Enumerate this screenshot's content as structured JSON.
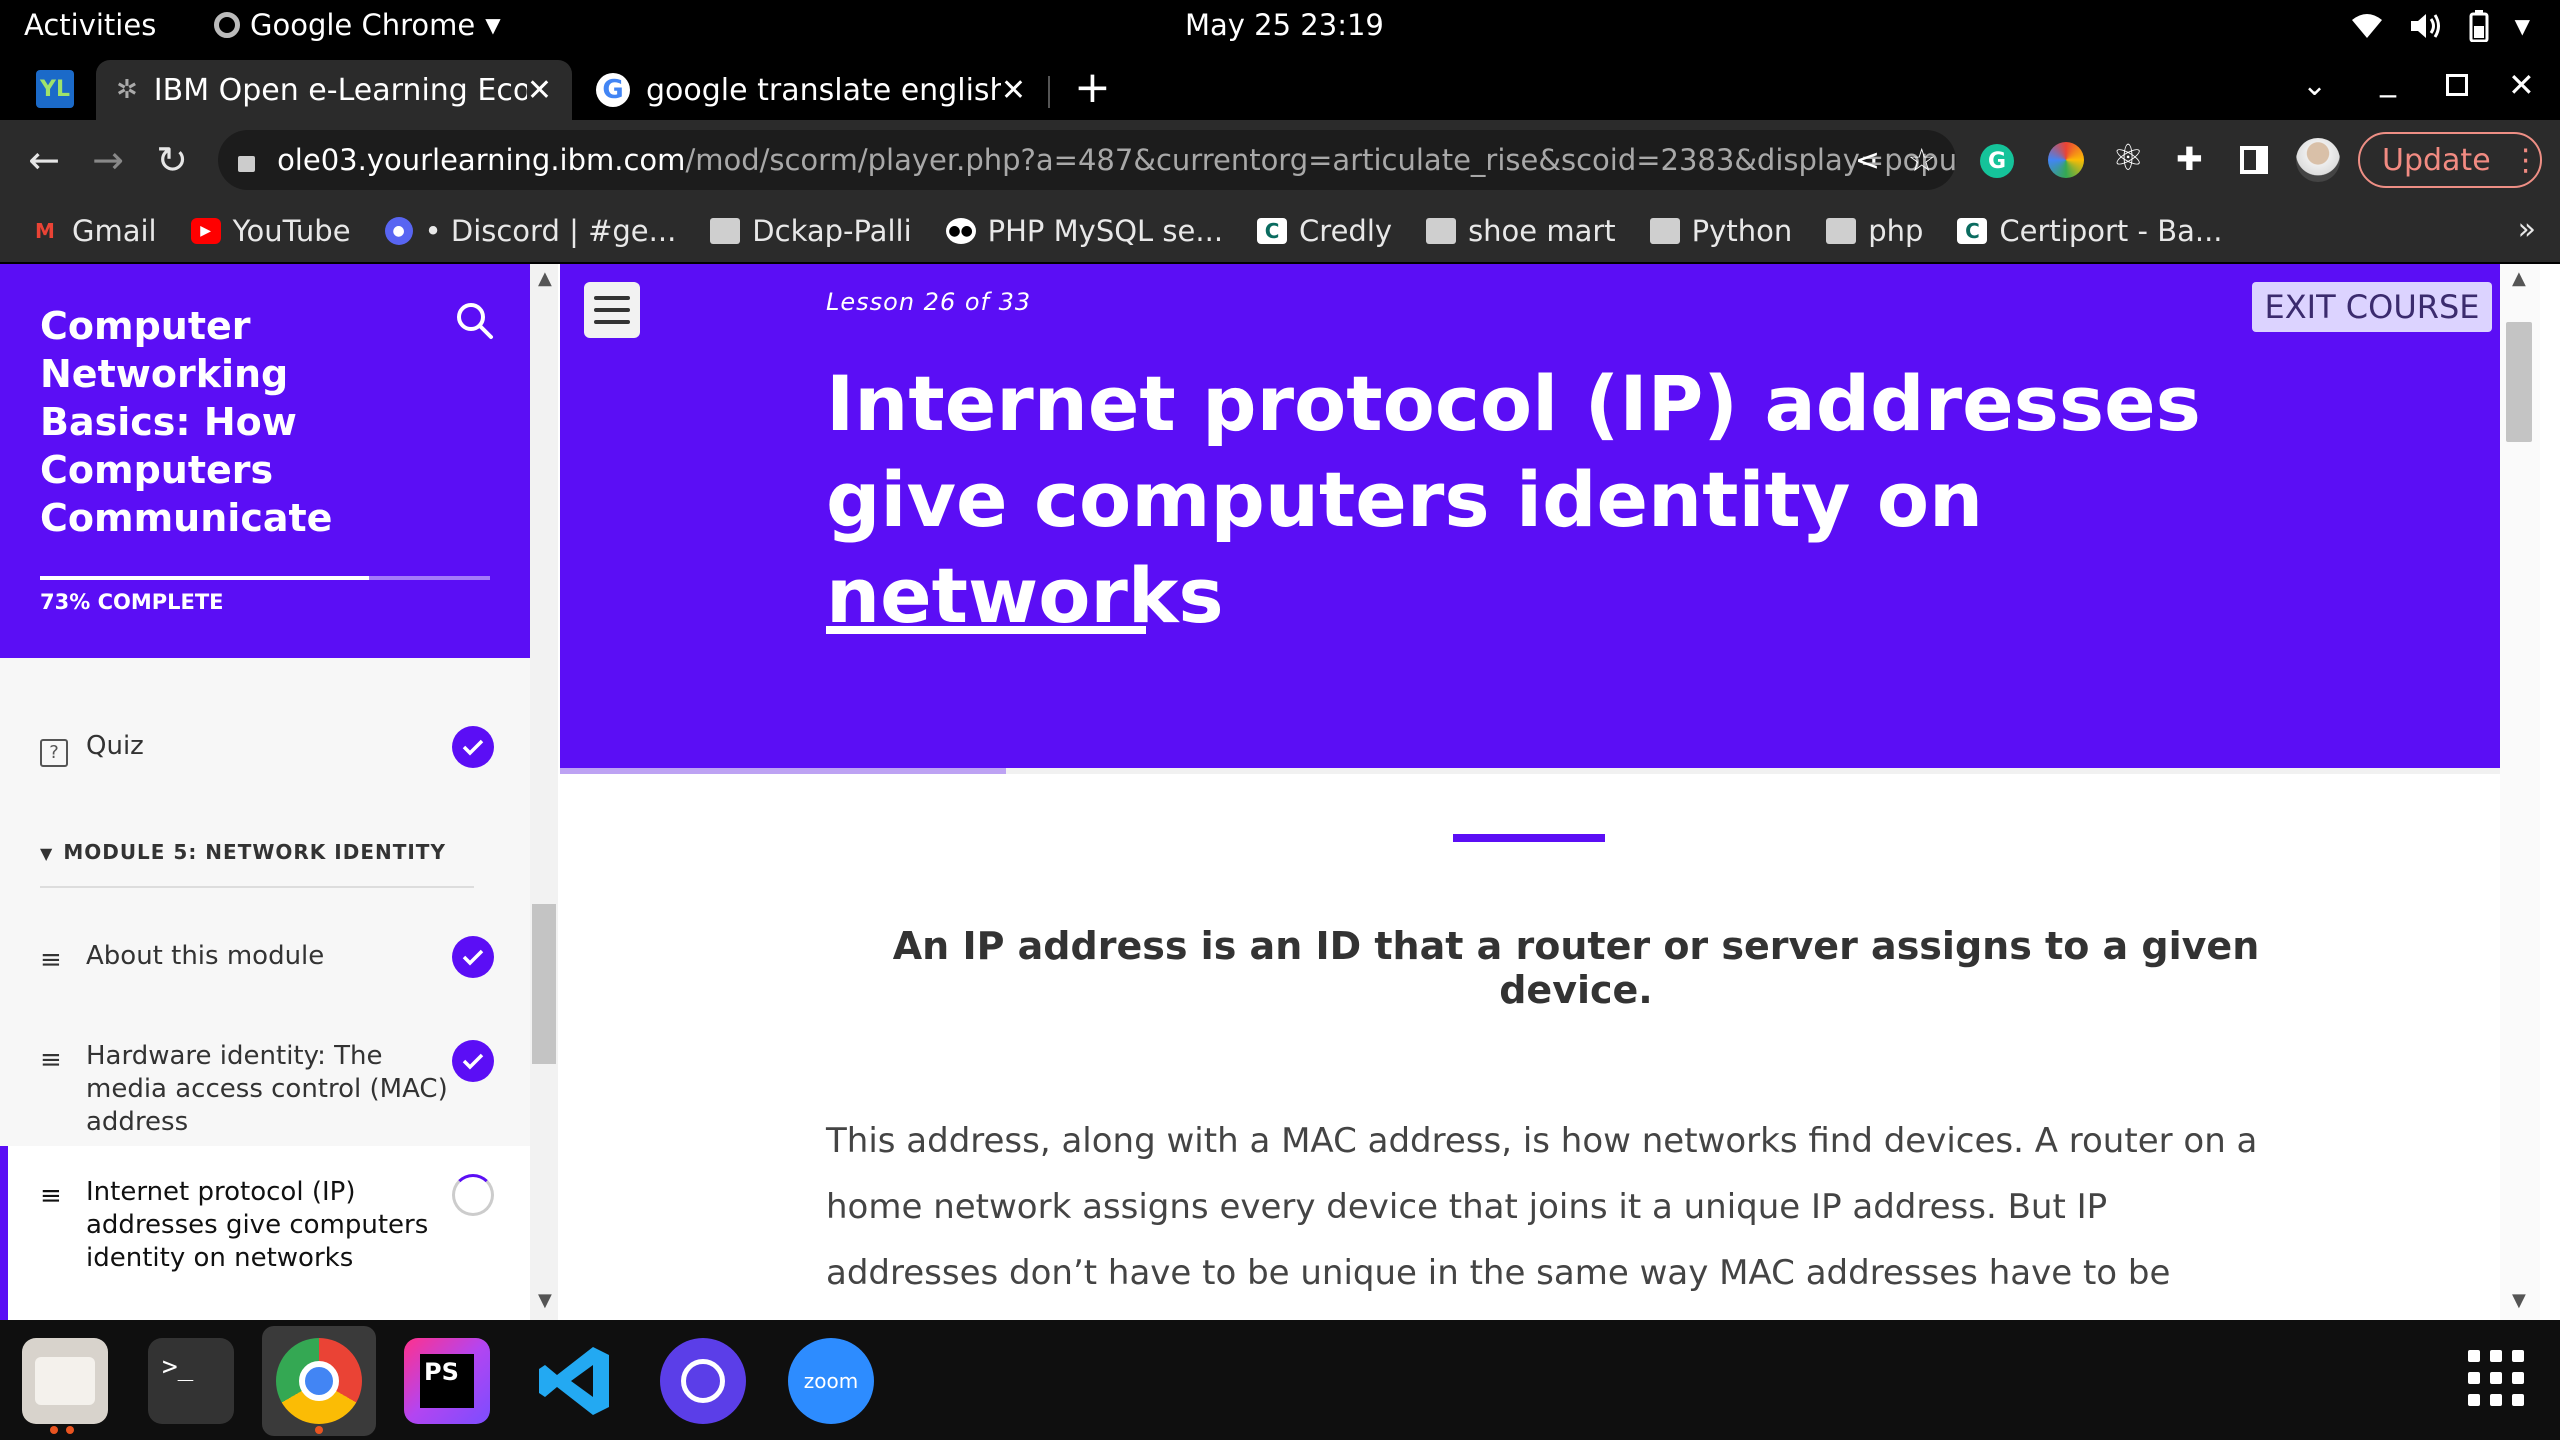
{
  "topbar": {
    "activities": "Activities",
    "app_name": "Google Chrome",
    "clock": "May 25  23:19"
  },
  "tabs": [
    {
      "title": "IBM Open e-Learning Ecos",
      "active": true
    },
    {
      "title": "google translate english t",
      "active": false
    }
  ],
  "omnibox": {
    "host": "ole03.yourlearning.ibm.com",
    "path": "/mod/scorm/player.php?a=487&currentorg=articulate_rise&scoid=2383&display=popup&..."
  },
  "update_label": "Update",
  "bookmarks": [
    {
      "label": "Gmail",
      "icon": "gmail-icon"
    },
    {
      "label": "YouTube",
      "icon": "youtube-icon"
    },
    {
      "label": "• Discord | #ge...",
      "icon": "discord-icon"
    },
    {
      "label": "Dckap-Palli",
      "icon": "folder-icon"
    },
    {
      "label": "PHP MySQL se...",
      "icon": "site-icon"
    },
    {
      "label": "Credly",
      "icon": "credly-icon"
    },
    {
      "label": "shoe mart",
      "icon": "folder-icon"
    },
    {
      "label": "Python",
      "icon": "folder-icon"
    },
    {
      "label": "php",
      "icon": "folder-icon"
    },
    {
      "label": "Certiport - Ba...",
      "icon": "certiport-icon"
    }
  ],
  "sidebar": {
    "course_title": "Computer Networking Basics: How Computers Communicate",
    "progress": 0.73,
    "progress_label": "73% COMPLETE",
    "quiz_label": "Quiz",
    "module_label": "MODULE 5: NETWORK IDENTITY",
    "lessons": [
      {
        "label": "About this module",
        "status": "complete"
      },
      {
        "label": "Hardware identity: The media access control (MAC) address",
        "status": "complete"
      },
      {
        "label": "Internet protocol (IP) addresses give computers identity on networks",
        "status": "in-progress"
      }
    ]
  },
  "lesson": {
    "counter": "Lesson 26 of 33",
    "exit_label": "EXIT COURSE",
    "title": "Internet protocol (IP) addresses give computers identity on networks",
    "lead": "An IP address is an ID that a router or server assigns to a given device.",
    "body": "This address, along with a MAC address, is how networks find devices. A router on a home network assigns every device that joins it a unique IP address. But IP addresses don’t have to be unique in the same way MAC addresses have to be unique.",
    "scroll_progress": 0.23
  },
  "colors": {
    "brand": "#5b0ef5",
    "update": "#f28b82"
  }
}
